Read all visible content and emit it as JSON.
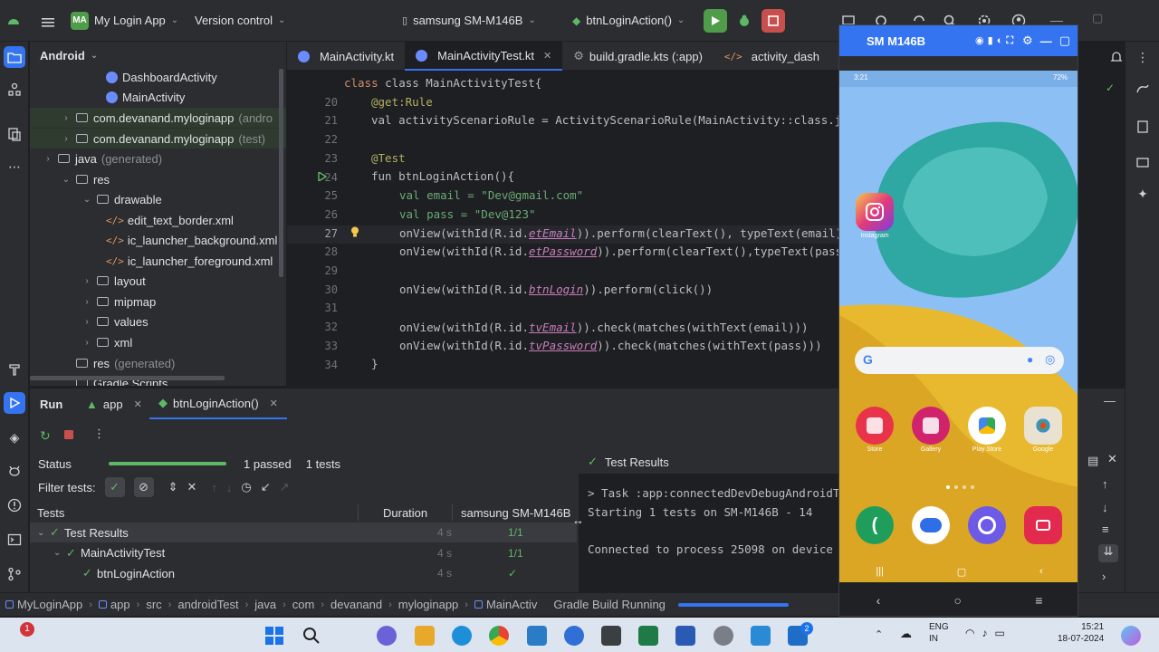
{
  "topbar": {
    "project_badge": "MA",
    "project_name": "My Login App",
    "vcs": "Version control",
    "device": "samsung SM-M146B",
    "run_config": "btnLoginAction()"
  },
  "project_panel": {
    "title": "Android",
    "rows": [
      {
        "label": "DashboardActivity",
        "suffix": ""
      },
      {
        "label": "MainActivity",
        "suffix": ""
      },
      {
        "label": "com.devanand.myloginapp",
        "suffix": "(andro"
      },
      {
        "label": "com.devanand.myloginapp",
        "suffix": "(test)"
      },
      {
        "label": "java",
        "suffix": "(generated)"
      },
      {
        "label": "res",
        "suffix": ""
      },
      {
        "label": "drawable",
        "suffix": ""
      },
      {
        "label": "edit_text_border.xml",
        "suffix": ""
      },
      {
        "label": "ic_launcher_background.xml",
        "suffix": ""
      },
      {
        "label": "ic_launcher_foreground.xml",
        "suffix": ""
      },
      {
        "label": "layout",
        "suffix": ""
      },
      {
        "label": "mipmap",
        "suffix": ""
      },
      {
        "label": "values",
        "suffix": ""
      },
      {
        "label": "xml",
        "suffix": ""
      },
      {
        "label": "res",
        "suffix": "(generated)"
      },
      {
        "label": "Gradle Scripts",
        "suffix": ""
      }
    ]
  },
  "editor_tabs": [
    "MainActivity.kt",
    "MainActivityTest.kt",
    "build.gradle.kts (:app)",
    "activity_dash"
  ],
  "code": {
    "line_numbers": [
      "",
      "20",
      "21",
      "22",
      "23",
      "24",
      "25",
      "26",
      "27",
      "28",
      "29",
      "30",
      "31",
      "32",
      "33",
      "34"
    ],
    "class_decl": "class MainActivityTest{",
    "get_rule": "@get:Rule",
    "rule_val": "val activityScenarioRule = ActivityScenarioRule(MainActivity::class.j",
    "test_ann": "@Test",
    "fun_decl": "fun btnLoginAction(){",
    "email_line": "val email = \"Dev@gmail.com\"",
    "pass_line": "val pass = \"Dev@123\"",
    "l27a": "onView(withId(R.id.",
    "l27id": "etEmail",
    "l27b": ")).perform(clearText(), typeText(email)",
    "l28a": "onView(withId(R.id.",
    "l28id": "etPassword",
    "l28b": ")).perform(clearText(),typeText(pass",
    "l30a": "onView(withId(R.id.",
    "l30id": "btnLogin",
    "l30b": ")).perform(click())",
    "l32a": "onView(withId(R.id.",
    "l32id": "tvEmail",
    "l32b": ")).check(matches(withText(email)))",
    "l33a": "onView(withId(R.id.",
    "l33id": "tvPassword",
    "l33b": ")).check(matches(withText(pass)))",
    "l34": "}"
  },
  "run_panel": {
    "title": "Run",
    "tabs": [
      "app",
      "btnLoginAction()"
    ],
    "status_label": "Status",
    "passed": "1 passed",
    "tests_count": "1 tests",
    "filter_label": "Filter tests:",
    "col_tests": "Tests",
    "col_duration": "Duration",
    "col_device": "samsung SM-M146B",
    "rows": [
      {
        "name": "Test Results",
        "duration": "4 s",
        "result": "1/1"
      },
      {
        "name": "MainActivityTest",
        "duration": "4 s",
        "result": "1/1"
      },
      {
        "name": "btnLoginAction",
        "duration": "4 s",
        "result": "✓"
      }
    ],
    "results_title": "Test Results",
    "console": [
      "> Task :app:connectedDevDebugAndroidT",
      "Starting 1 tests on SM-M146B - 14",
      "",
      "Connected to process 25098 on device"
    ]
  },
  "emulator": {
    "title": "SM M146B",
    "time": "3:21",
    "battery": "72%",
    "apps_row": [
      {
        "label": "Store",
        "color": "#e8334a"
      },
      {
        "label": "Gallery",
        "color": "#d1236b"
      },
      {
        "label": "Play Store",
        "color": "#ffffff"
      },
      {
        "label": "Google",
        "color": "#e9e2d0"
      }
    ],
    "instagram_label": "Instagram"
  },
  "breadcrumb": [
    "MyLoginApp",
    "app",
    "src",
    "androidTest",
    "java",
    "com",
    "devanand",
    "myloginapp",
    "MainActiv"
  ],
  "gradle_status": "Gradle Build Running",
  "taskbar": {
    "lang": "ENG",
    "lang2": "IN",
    "time": "15:21",
    "date": "18-07-2024",
    "notif_count": "1",
    "badge2": "2"
  }
}
